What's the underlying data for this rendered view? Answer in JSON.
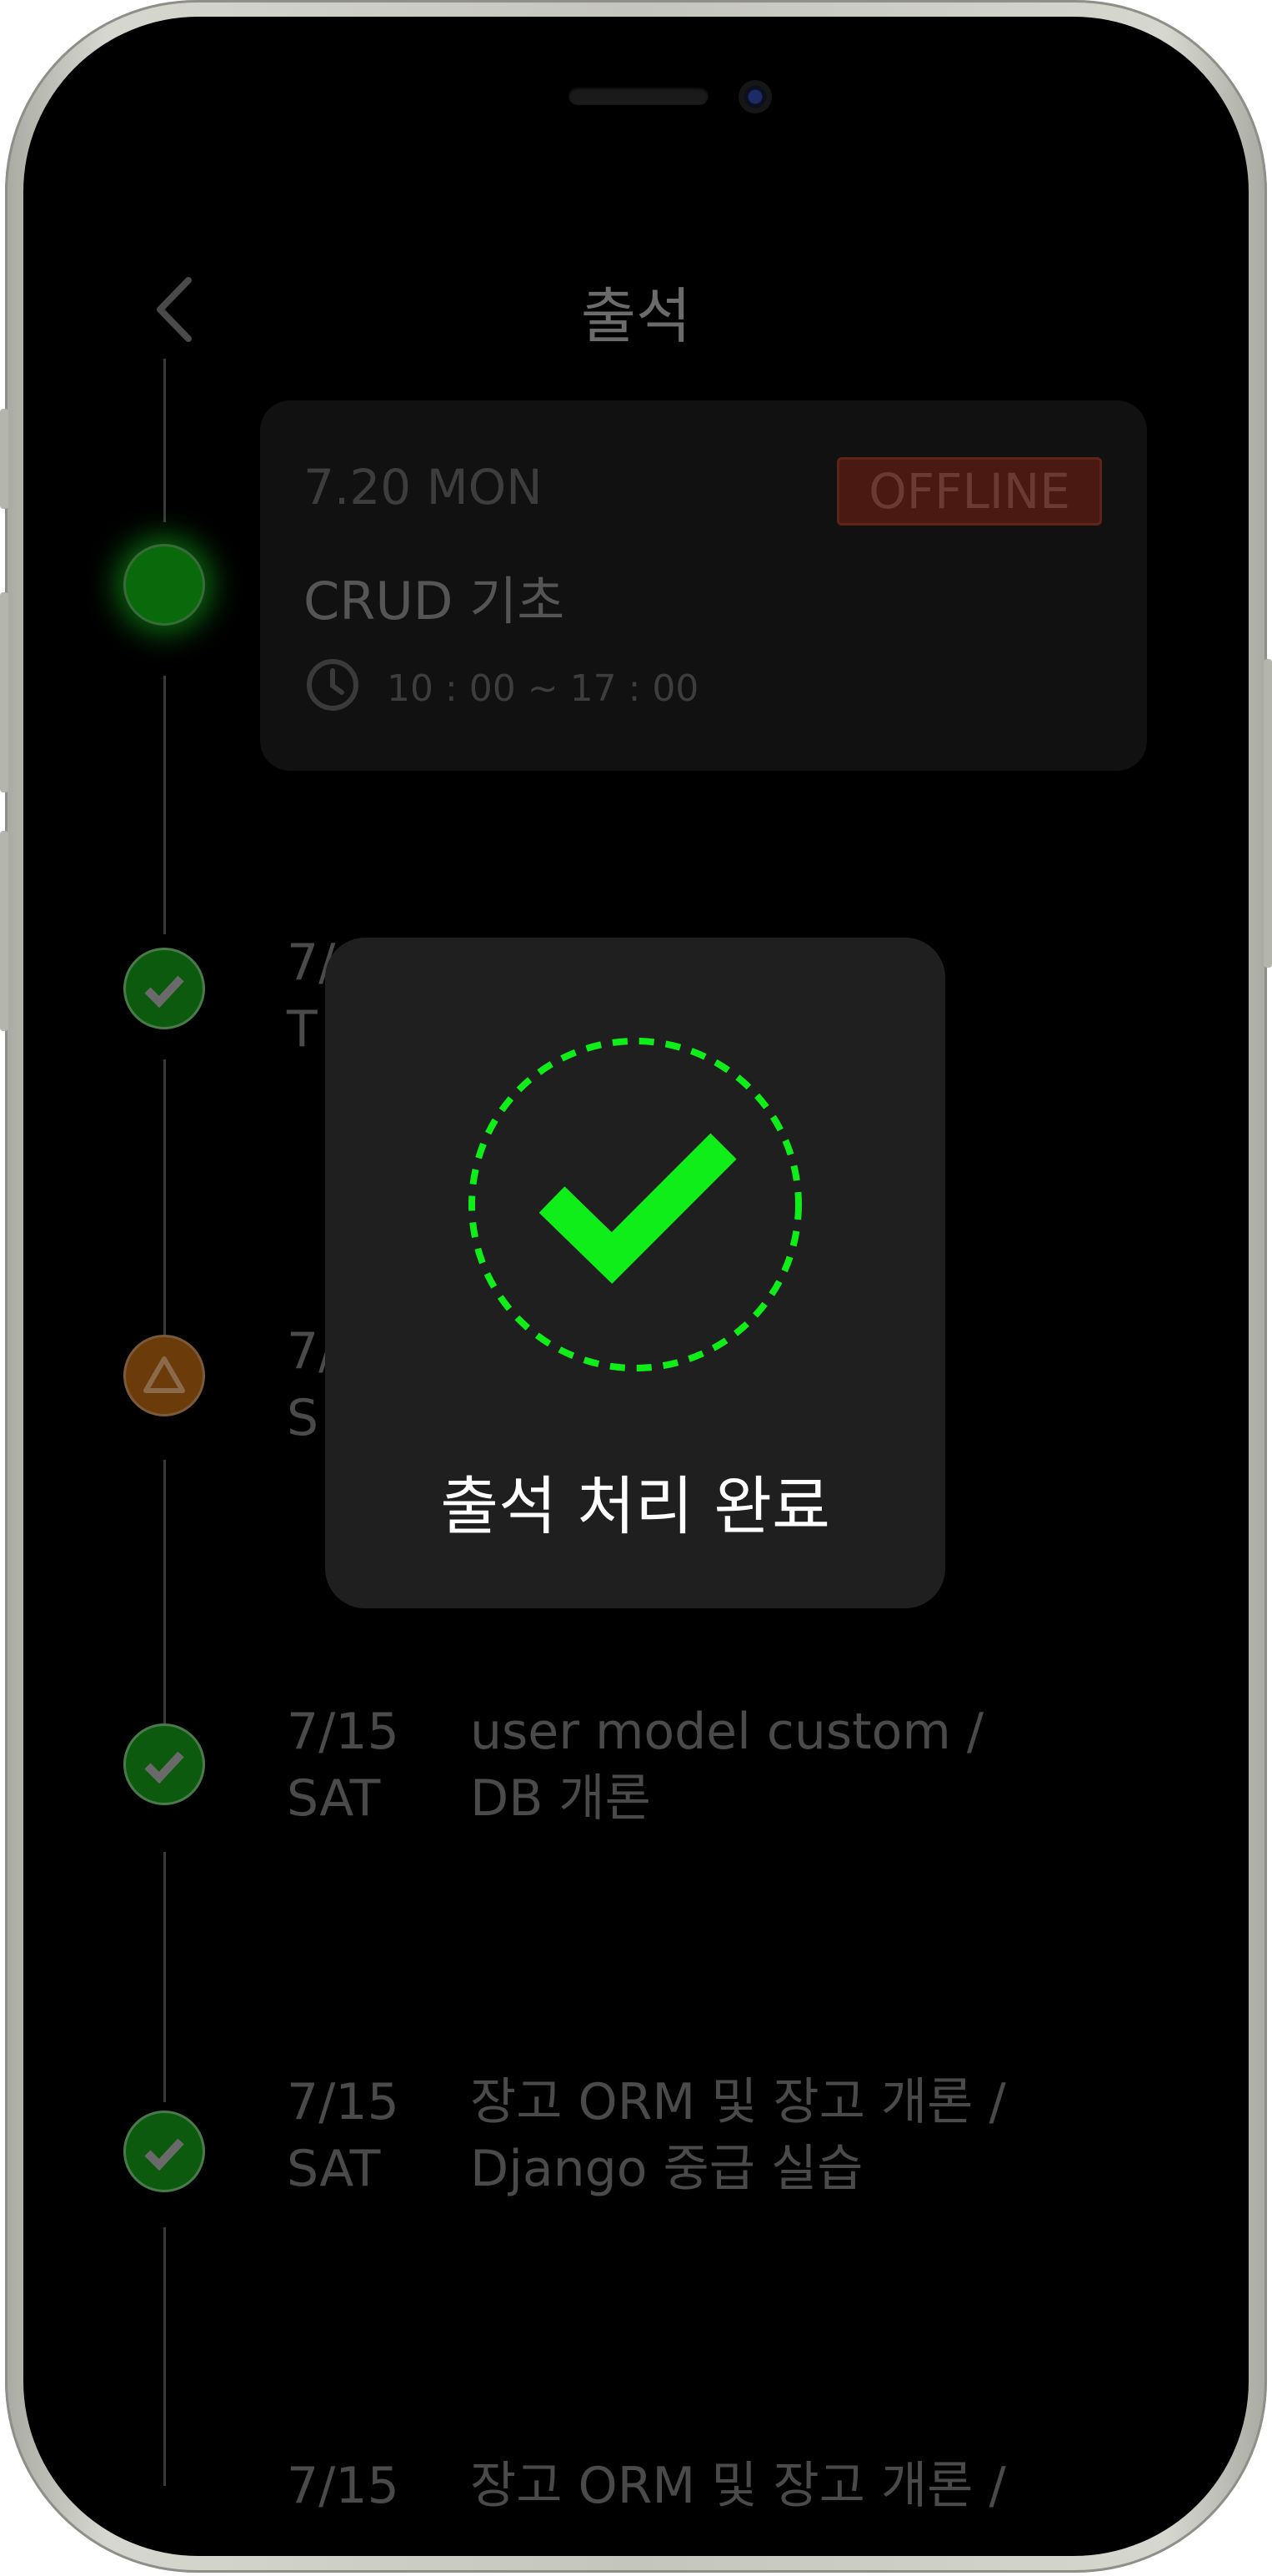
{
  "header": {
    "title": "출석"
  },
  "card": {
    "date": "7.20 MON",
    "badge": "OFFLINE",
    "title": "CRUD 기초",
    "time": "10 : 00  ~ 17 : 00"
  },
  "sessions": [
    {
      "date_line1": "7/",
      "date_line2": "T",
      "title_line1": "",
      "title_line2": "",
      "status": "check"
    },
    {
      "date_line1": "7/",
      "date_line2": "S",
      "title_line1": "",
      "title_line2": "",
      "status": "warning"
    },
    {
      "date_line1": "7/15",
      "date_line2": "SAT",
      "title_line1": "user model custom /",
      "title_line2": "DB 개론",
      "status": "check"
    },
    {
      "date_line1": "7/15",
      "date_line2": "SAT",
      "title_line1": "장고 ORM 및 장고 개론 /",
      "title_line2": "Django 중급 실습",
      "status": "check"
    },
    {
      "date_line1": "7/15",
      "date_line2": "",
      "title_line1": "장고 ORM 및 장고 개론 /",
      "title_line2": "",
      "status": "partial"
    }
  ],
  "modal": {
    "message": "출석 처리 완료"
  },
  "colors": {
    "success": "#10ee1a",
    "modal_bg": "#1f1f1f",
    "badge_bg": "#4a1a12"
  },
  "icons": {
    "back": "chevron-left-icon",
    "clock": "clock-icon",
    "check": "check-icon",
    "warning": "triangle-icon"
  }
}
